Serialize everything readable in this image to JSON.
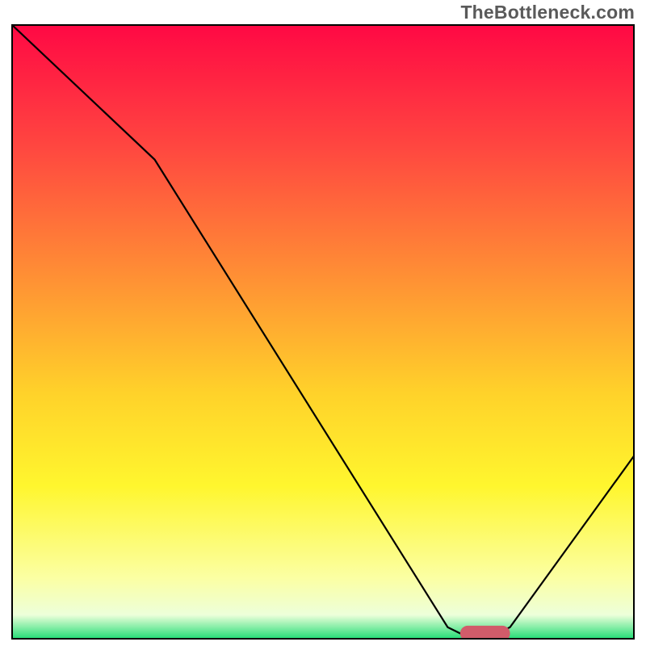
{
  "watermark": "TheBottleneck.com",
  "chart_data": {
    "type": "line",
    "title": "",
    "xlabel": "",
    "ylabel": "",
    "xlim": [
      0,
      100
    ],
    "ylim": [
      0,
      100
    ],
    "background_gradient": [
      {
        "pos": 0,
        "color": "#ff0844"
      },
      {
        "pos": 20,
        "color": "#ff4740"
      },
      {
        "pos": 40,
        "color": "#ff8c35"
      },
      {
        "pos": 60,
        "color": "#ffd22a"
      },
      {
        "pos": 75,
        "color": "#fff62e"
      },
      {
        "pos": 90,
        "color": "#fbffa3"
      },
      {
        "pos": 96,
        "color": "#edffda"
      },
      {
        "pos": 100,
        "color": "#1ddc73"
      }
    ],
    "series": [
      {
        "name": "bottleneck-curve",
        "color": "#000000",
        "points": [
          {
            "x": 0,
            "y": 100
          },
          {
            "x": 23,
            "y": 78
          },
          {
            "x": 70,
            "y": 2
          },
          {
            "x": 72,
            "y": 1
          },
          {
            "x": 78,
            "y": 1
          },
          {
            "x": 80,
            "y": 2
          },
          {
            "x": 100,
            "y": 30
          }
        ]
      }
    ],
    "markers": [
      {
        "name": "highlight-segment",
        "color": "#d15c6a",
        "y": 1,
        "x_start": 72,
        "x_end": 80,
        "thickness": 2.5
      }
    ],
    "grid": false,
    "legend": false,
    "axes_visible": false,
    "border": {
      "color": "#000000",
      "width": 2
    }
  }
}
